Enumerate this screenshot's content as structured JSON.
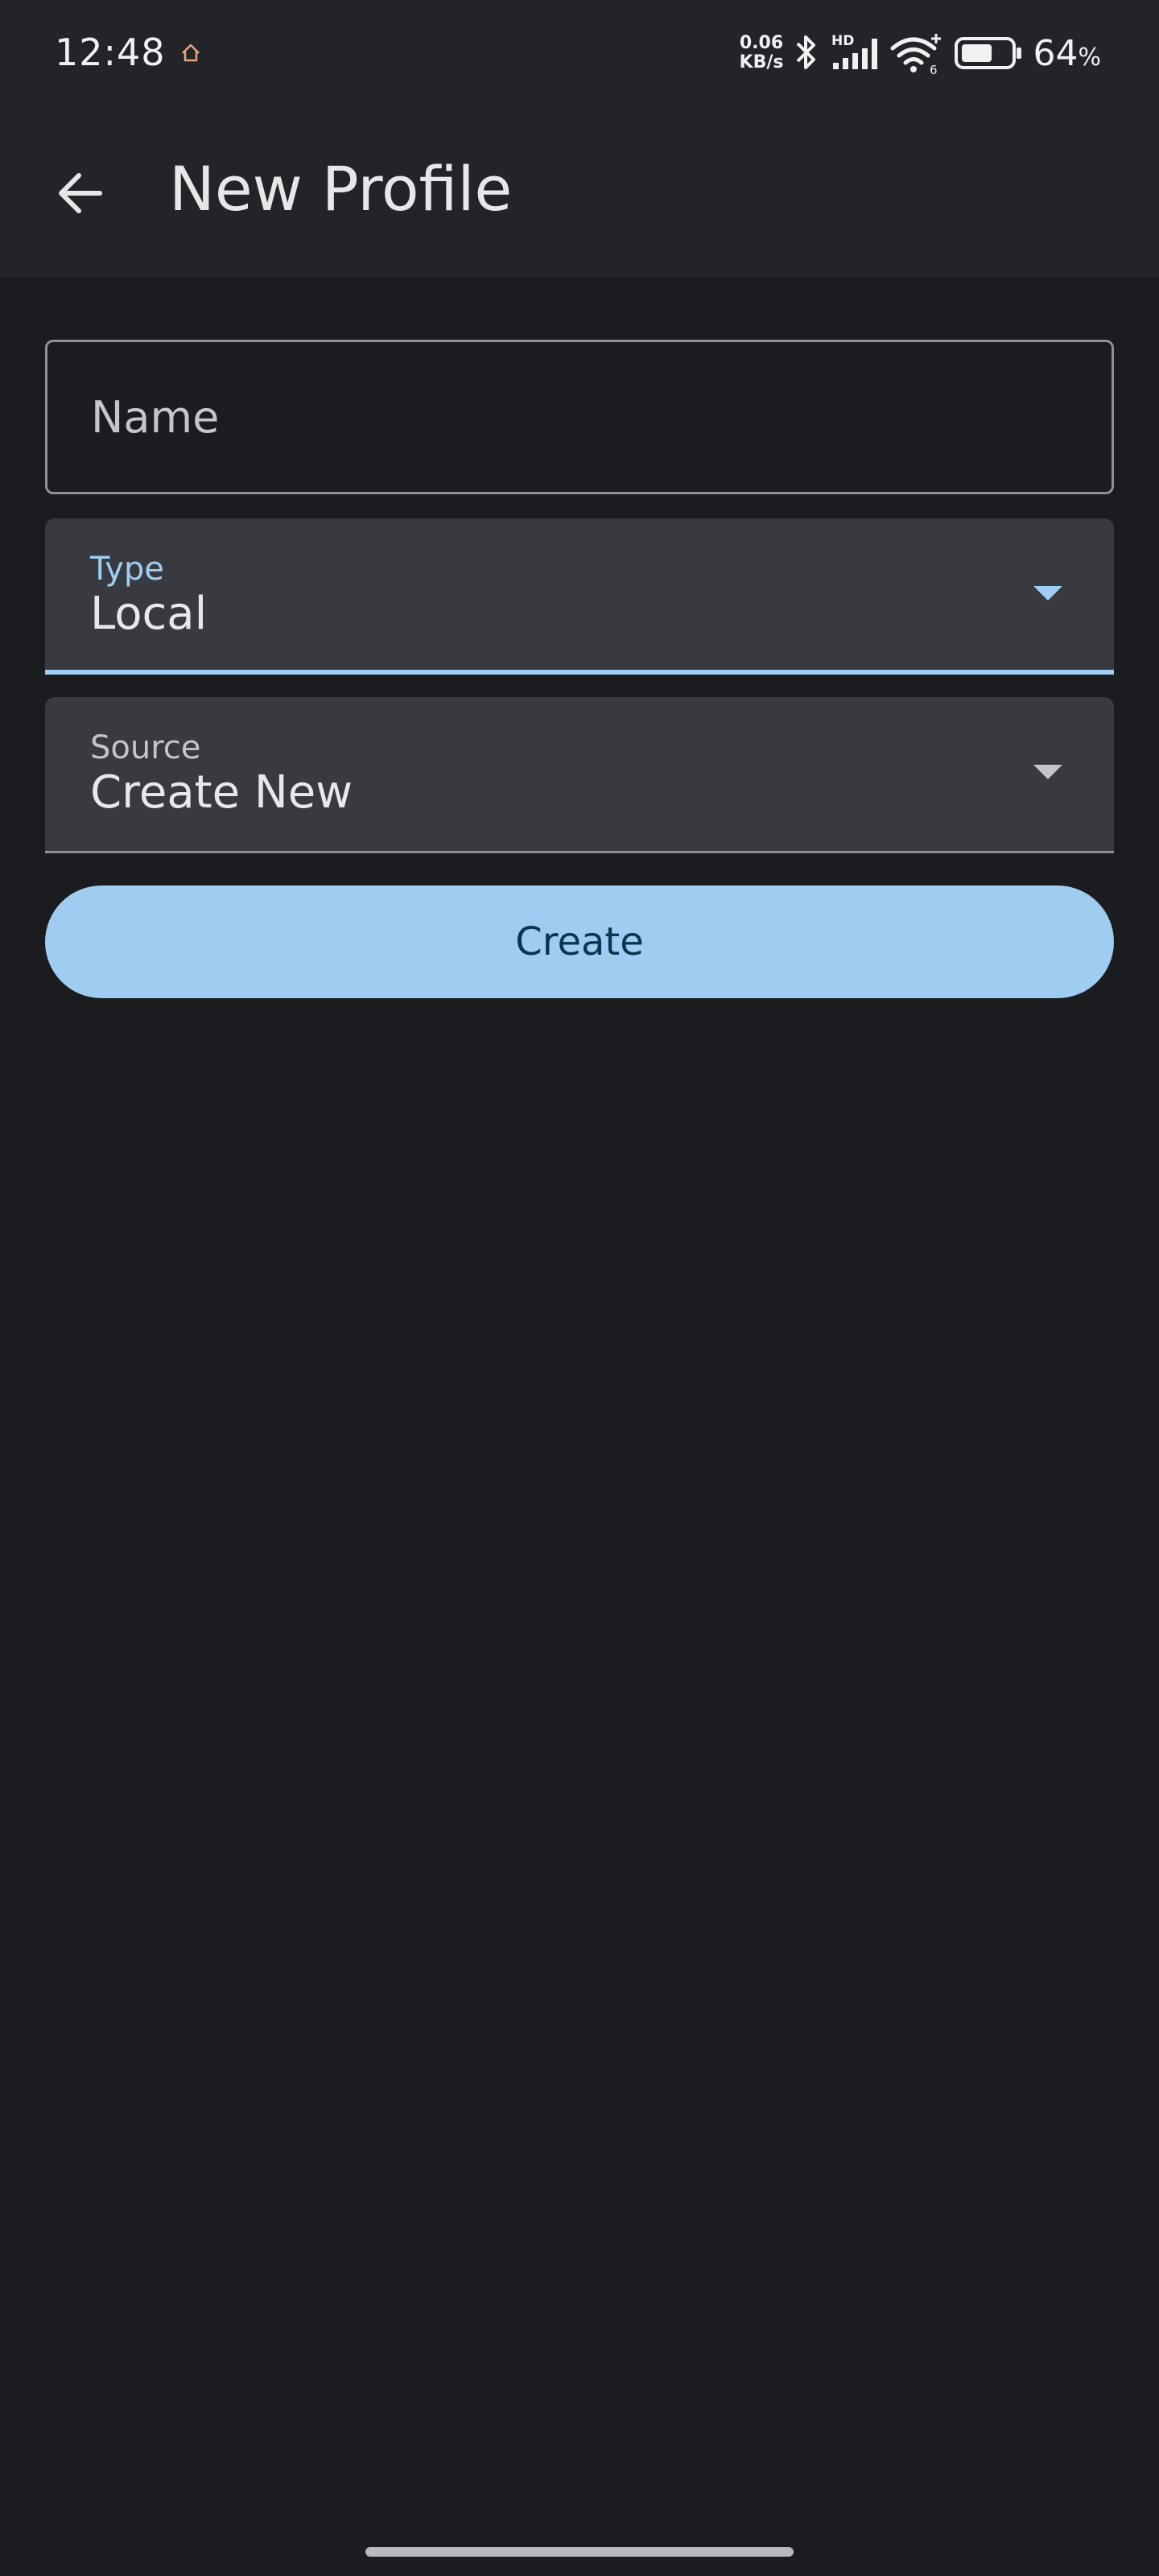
{
  "status_bar": {
    "time": "12:48",
    "net_speed_value": "0.06",
    "net_speed_unit": "KB/s",
    "network_badge": "HD",
    "wifi_badge": "6",
    "battery_percent": "64",
    "battery_percent_unit": "%",
    "battery_level_fraction": 0.64,
    "icons": [
      "home-icon",
      "bluetooth-icon",
      "signal-icon",
      "wifi-icon",
      "battery-icon"
    ]
  },
  "app_bar": {
    "back_icon": "arrow-back-icon",
    "title": "New Profile"
  },
  "form": {
    "name_placeholder": "Name",
    "name_value": "",
    "type": {
      "label": "Type",
      "value": "Local",
      "icon": "dropdown-arrow-icon"
    },
    "source": {
      "label": "Source",
      "value": "Create New",
      "icon": "dropdown-arrow-icon"
    },
    "submit_label": "Create"
  },
  "colors": {
    "background": "#1a1c1f",
    "app_bar": "#222428",
    "field_fill": "#383a40",
    "accent": "#9fcef2",
    "button_text": "#0d3551"
  }
}
